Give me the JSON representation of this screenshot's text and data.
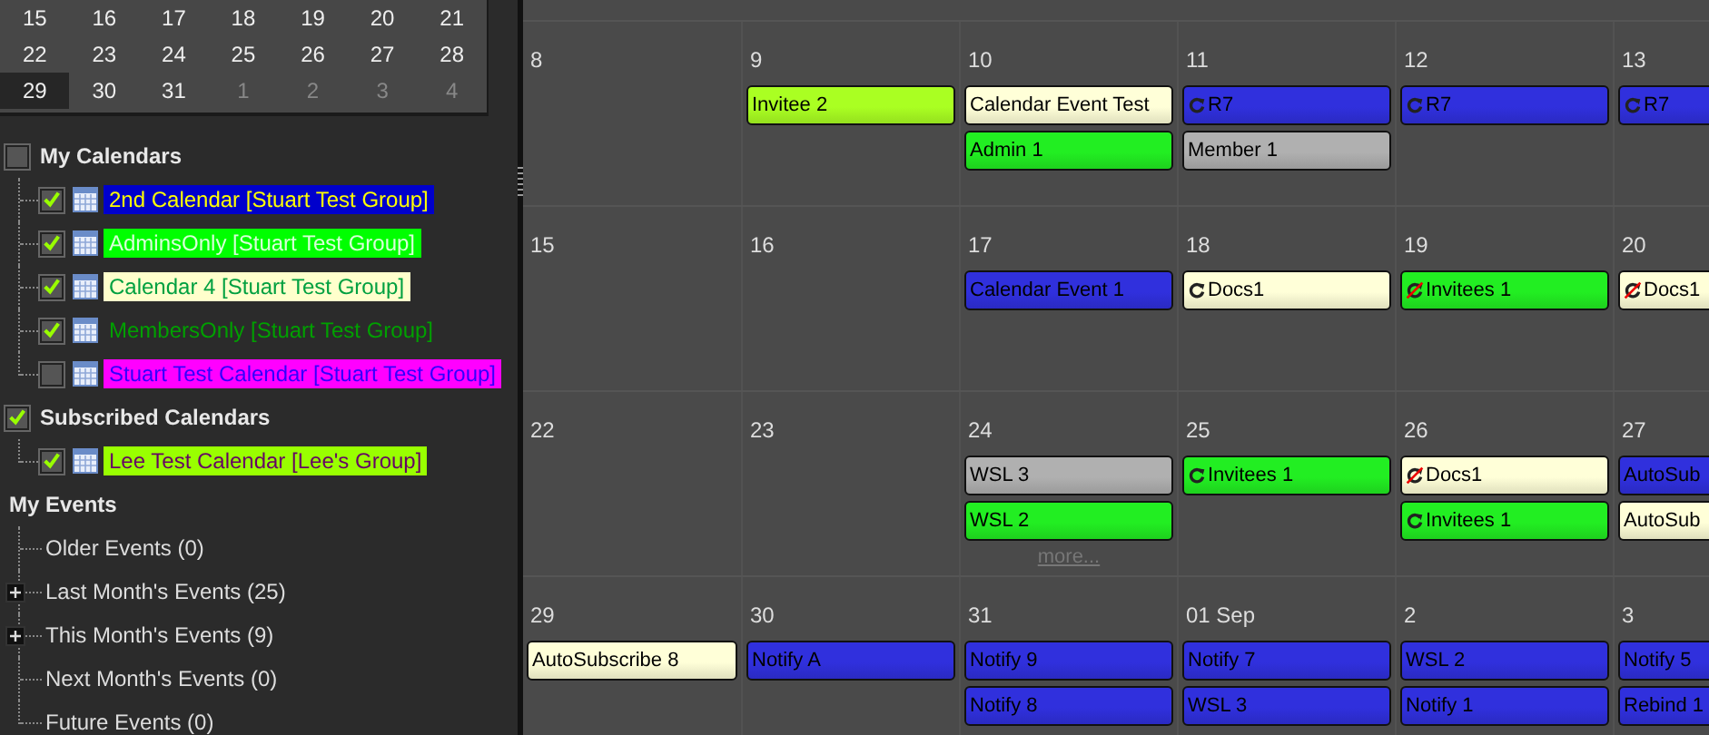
{
  "mini_calendar": {
    "weeks": [
      [
        {
          "day": "15",
          "other_month": false,
          "selected": false
        },
        {
          "day": "16",
          "other_month": false,
          "selected": false
        },
        {
          "day": "17",
          "other_month": false,
          "selected": false
        },
        {
          "day": "18",
          "other_month": false,
          "selected": false
        },
        {
          "day": "19",
          "other_month": false,
          "selected": false
        },
        {
          "day": "20",
          "other_month": false,
          "selected": false
        },
        {
          "day": "21",
          "other_month": false,
          "selected": false
        }
      ],
      [
        {
          "day": "22",
          "other_month": false,
          "selected": false
        },
        {
          "day": "23",
          "other_month": false,
          "selected": false
        },
        {
          "day": "24",
          "other_month": false,
          "selected": false
        },
        {
          "day": "25",
          "other_month": false,
          "selected": false
        },
        {
          "day": "26",
          "other_month": false,
          "selected": false
        },
        {
          "day": "27",
          "other_month": false,
          "selected": false
        },
        {
          "day": "28",
          "other_month": false,
          "selected": false
        }
      ],
      [
        {
          "day": "29",
          "other_month": false,
          "selected": true
        },
        {
          "day": "30",
          "other_month": false,
          "selected": false
        },
        {
          "day": "31",
          "other_month": false,
          "selected": false
        },
        {
          "day": "1",
          "other_month": true,
          "selected": false
        },
        {
          "day": "2",
          "other_month": true,
          "selected": false
        },
        {
          "day": "3",
          "other_month": true,
          "selected": false
        },
        {
          "day": "4",
          "other_month": true,
          "selected": false
        }
      ]
    ]
  },
  "calendar_groups": [
    {
      "label": "My Calendars",
      "checked": false,
      "children": [
        {
          "label": {
            "text": "2nd Calendar [Stuart Test Group]",
            "color": "#ffff00"
          },
          "checked": true,
          "color": "#0000cc"
        },
        {
          "label": {
            "text": "AdminsOnly [Stuart Test Group]",
            "color": "#d8ffd8"
          },
          "checked": true,
          "color": "#00ff00"
        },
        {
          "label": {
            "text": "Calendar 4 [Stuart Test Group]",
            "color": "#00a040"
          },
          "checked": true,
          "color": "#ffffcc"
        },
        {
          "label": {
            "text": "MembersOnly [Stuart Test Group]",
            "color": "#00a000"
          },
          "checked": true
        },
        {
          "label": {
            "text": "Stuart Test Calendar [Stuart Test Group]",
            "color": "#3300ff"
          },
          "checked": false,
          "color": "#ff00ff"
        }
      ]
    },
    {
      "label": "Subscribed Calendars",
      "checked": true,
      "children": [
        {
          "label": {
            "text": "Lee Test Calendar [Lee's Group]",
            "color": "#660066"
          },
          "checked": true,
          "color": "#99ff00"
        }
      ]
    }
  ],
  "my_events": {
    "label": "My Events",
    "items": [
      {
        "label": "Older Events (0)",
        "expandable": false
      },
      {
        "label": "Last Month's Events (25)",
        "expandable": true
      },
      {
        "label": "This Month's Events (9)",
        "expandable": true
      },
      {
        "label": "Next Month's Events (0)",
        "expandable": false
      },
      {
        "label": "Future Events (0)",
        "expandable": false
      }
    ]
  },
  "month_grid": {
    "weeks": [
      [
        {
          "date": "8"
        },
        {
          "date": "9",
          "events": [
            {
              "title": "Invitee 2",
              "color": "#aaff22",
              "kind": "plain"
            }
          ]
        },
        {
          "date": "10",
          "events": [
            {
              "title": "Calendar Event Test",
              "color": "#ffffd8",
              "kind": "plain"
            },
            {
              "title": "Admin 1",
              "color": "#22ee22",
              "kind": "plain"
            }
          ]
        },
        {
          "date": "11",
          "events": [
            {
              "title": "R7",
              "color": "#3030dd",
              "kind": "repeat"
            },
            {
              "title": "Member 1",
              "color": "#b0b0b0",
              "kind": "plain"
            }
          ]
        },
        {
          "date": "12",
          "events": [
            {
              "title": "R7",
              "color": "#3030dd",
              "kind": "repeat"
            }
          ]
        },
        {
          "date": "13",
          "events": [
            {
              "title": "R7",
              "color": "#3030dd",
              "kind": "repeat"
            }
          ]
        }
      ],
      [
        {
          "date": "15"
        },
        {
          "date": "16"
        },
        {
          "date": "17",
          "events": [
            {
              "title": "Calendar Event 1",
              "color": "#3030dd",
              "kind": "plain"
            }
          ]
        },
        {
          "date": "18",
          "events": [
            {
              "title": "Docs1",
              "color": "#ffffd8",
              "kind": "repeat"
            }
          ]
        },
        {
          "date": "19",
          "events": [
            {
              "title": "Invitees 1",
              "color": "#22ee22",
              "kind": "repeat-off"
            }
          ]
        },
        {
          "date": "20",
          "events": [
            {
              "title": "Docs1",
              "color": "#ffffd8",
              "kind": "repeat-off"
            }
          ]
        }
      ],
      [
        {
          "date": "22"
        },
        {
          "date": "23"
        },
        {
          "date": "24",
          "events": [
            {
              "title": "WSL 3",
              "color": "#b0b0b0",
              "kind": "plain"
            },
            {
              "title": "WSL 2",
              "color": "#22ee22",
              "kind": "plain"
            }
          ],
          "more": "more..."
        },
        {
          "date": "25",
          "events": [
            {
              "title": "Invitees 1",
              "color": "#22ee22",
              "kind": "repeat"
            }
          ]
        },
        {
          "date": "26",
          "events": [
            {
              "title": "Docs1",
              "color": "#ffffd8",
              "kind": "repeat-off"
            },
            {
              "title": "Invitees 1",
              "color": "#22ee22",
              "kind": "repeat"
            }
          ]
        },
        {
          "date": "27",
          "events": [
            {
              "title": "AutoSub",
              "color": "#3030dd",
              "kind": "plain"
            },
            {
              "title": "AutoSub",
              "color": "#ffffd8",
              "kind": "plain"
            }
          ]
        }
      ],
      [
        {
          "date": "29",
          "events": [
            {
              "title": "AutoSubscribe 8",
              "color": "#ffffd8",
              "kind": "plain"
            }
          ]
        },
        {
          "date": "30",
          "events": [
            {
              "title": "Notify A",
              "color": "#3030dd",
              "kind": "plain"
            }
          ]
        },
        {
          "date": "31",
          "events": [
            {
              "title": "Notify 9",
              "color": "#3030dd",
              "kind": "plain"
            },
            {
              "title": "Notify 8",
              "color": "#3030dd",
              "kind": "plain"
            }
          ]
        },
        {
          "date": "01 Sep",
          "events": [
            {
              "title": "Notify 7",
              "color": "#3030dd",
              "kind": "plain"
            },
            {
              "title": "WSL 3",
              "color": "#3030dd",
              "kind": "plain"
            }
          ]
        },
        {
          "date": "2",
          "events": [
            {
              "title": "WSL 2",
              "color": "#3030dd",
              "kind": "plain"
            },
            {
              "title": "Notify 1",
              "color": "#3030dd",
              "kind": "plain"
            }
          ]
        },
        {
          "date": "3",
          "events": [
            {
              "title": "Notify 5",
              "color": "#3030dd",
              "kind": "plain"
            },
            {
              "title": "Rebind 1",
              "color": "#3030dd",
              "kind": "plain"
            }
          ]
        }
      ]
    ]
  }
}
